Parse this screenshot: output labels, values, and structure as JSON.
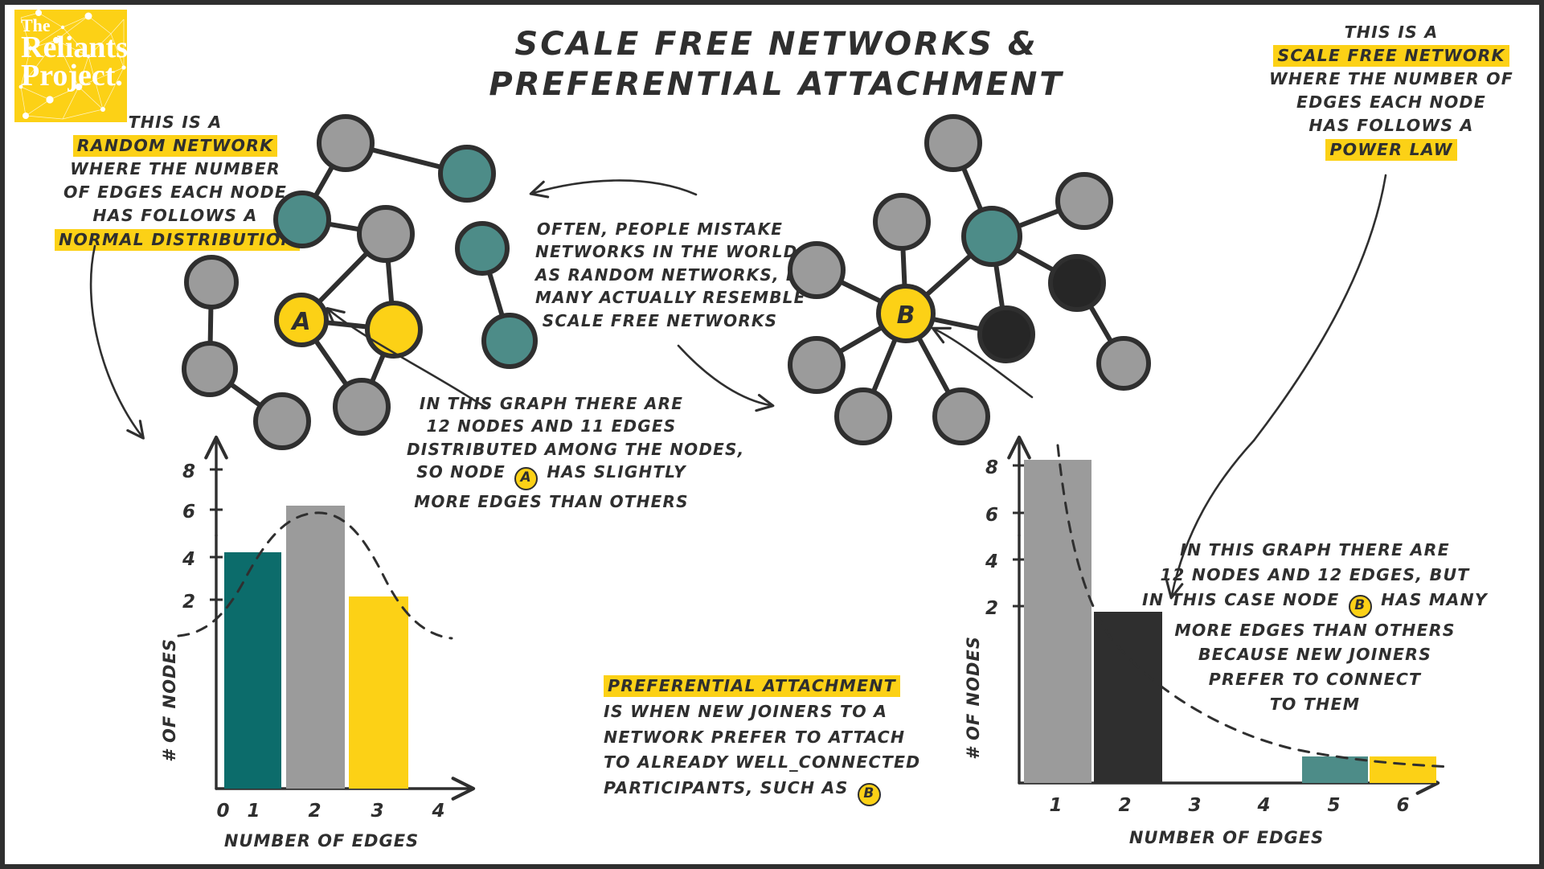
{
  "logo": {
    "line1": "The",
    "line2": "Reliants",
    "line3": "Project."
  },
  "title": {
    "line1": "SCALE FREE NETWORKS &",
    "line2": "PREFERENTIAL ATTACHMENT"
  },
  "annotations": {
    "left": {
      "lines": [
        "THIS IS A",
        "RANDOM NETWORK",
        "WHERE THE NUMBER",
        "OF EDGES EACH NODE",
        "HAS FOLLOWS A",
        "NORMAL DISTRIBUTION"
      ],
      "highlighted": [
        1,
        5
      ]
    },
    "right": {
      "lines": [
        "THIS IS A",
        "SCALE FREE NETWORK",
        "WHERE THE NUMBER OF",
        "EDGES EACH NODE",
        "HAS FOLLOWS A",
        "POWER LAW"
      ],
      "highlighted": [
        1,
        5
      ]
    },
    "center": {
      "lines": [
        "OFTEN, PEOPLE MISTAKE",
        "NETWORKS IN THE WORLD",
        "AS RANDOM NETWORKS, BUT",
        "MANY ACTUALLY RESEMBLE",
        "SCALE FREE NETWORKS"
      ]
    },
    "graph_a": {
      "line1": "IN THIS GRAPH THERE ARE",
      "line2": "12 NODES AND 11 EDGES",
      "line3": "DISTRIBUTED AMONG THE NODES,",
      "line4_pre": "SO NODE",
      "line4_chip": "A",
      "line4_post": "HAS SLIGHTLY",
      "line5": "MORE EDGES THAN OTHERS"
    },
    "preferential": {
      "heading": "PREFERENTIAL ATTACHMENT",
      "line1": "IS WHEN NEW JOINERS TO A",
      "line2": "NETWORK PREFER TO ATTACH",
      "line3": "TO ALREADY WELL_CONNECTED",
      "line4_pre": "PARTICIPANTS, SUCH AS",
      "line4_chip": "B"
    },
    "graph_b": {
      "line1": "IN THIS GRAPH THERE ARE",
      "line2": "12 NODES AND 12 EDGES, BUT",
      "line3_pre": "IN THIS CASE NODE",
      "line3_chip": "B",
      "line3_post": "HAS MANY",
      "line4": "MORE EDGES THAN OTHERS",
      "line5": "BECAUSE NEW JOINERS",
      "line6": "PREFER TO CONNECT",
      "line7": "TO THEM"
    }
  },
  "networks": {
    "random": {
      "hub_label": "A",
      "node_count": 12,
      "edge_count": 11
    },
    "scale_free": {
      "hub_label": "B",
      "node_count": 12,
      "edge_count": 12
    }
  },
  "colors": {
    "yellow": "#fcd116",
    "teal": "#4d8c88",
    "teal_bar": "#0c6c6b",
    "gray": "#9b9b9b",
    "dark": "#2f2f2f",
    "ink": "#2f2f2f"
  },
  "chart_data": [
    {
      "type": "bar",
      "title": "",
      "xlabel": "NUMBER OF EDGES",
      "ylabel": "# OF NODES",
      "categories": [
        "0",
        "1",
        "2",
        "3",
        "4"
      ],
      "values": [
        0,
        4,
        6,
        2,
        0
      ],
      "bar_colors": [
        "none",
        "#0c6c6b",
        "#9b9b9b",
        "#fcd116",
        "none"
      ],
      "ytick_labels": [
        "2",
        "4",
        "6",
        "8"
      ],
      "yticks": [
        2,
        4,
        6,
        8
      ],
      "ylim": [
        0,
        9
      ],
      "grid": false,
      "overlay_curve": "normal distribution (dashed)",
      "legend": "none"
    },
    {
      "type": "bar",
      "title": "",
      "xlabel": "NUMBER OF EDGES",
      "ylabel": "# OF NODES",
      "categories": [
        "1",
        "2",
        "3",
        "4",
        "5",
        "6"
      ],
      "values": [
        8.2,
        1.9,
        0,
        0,
        1,
        1
      ],
      "bar_colors": [
        "#9b9b9b",
        "#2f2f2f",
        "none",
        "none",
        "#4d8c88",
        "#fcd116"
      ],
      "ytick_labels": [
        "2",
        "4",
        "6",
        "8"
      ],
      "yticks": [
        2,
        4,
        6,
        8
      ],
      "ylim": [
        0,
        9
      ],
      "grid": false,
      "overlay_curve": "power law (dashed)",
      "legend": "none"
    }
  ],
  "chart_left_axis_marks": {
    "y": [
      "8",
      "6",
      "4",
      "2"
    ],
    "x": [
      "0",
      "1",
      "2",
      "3",
      "4"
    ],
    "xlabel": "NUMBER OF EDGES",
    "ylabel": "# OF NODES"
  },
  "chart_right_axis_marks": {
    "y": [
      "8",
      "6",
      "4",
      "2"
    ],
    "x": [
      "1",
      "2",
      "3",
      "4",
      "5",
      "6"
    ],
    "xlabel": "NUMBER OF EDGES",
    "ylabel": "# OF NODES"
  }
}
